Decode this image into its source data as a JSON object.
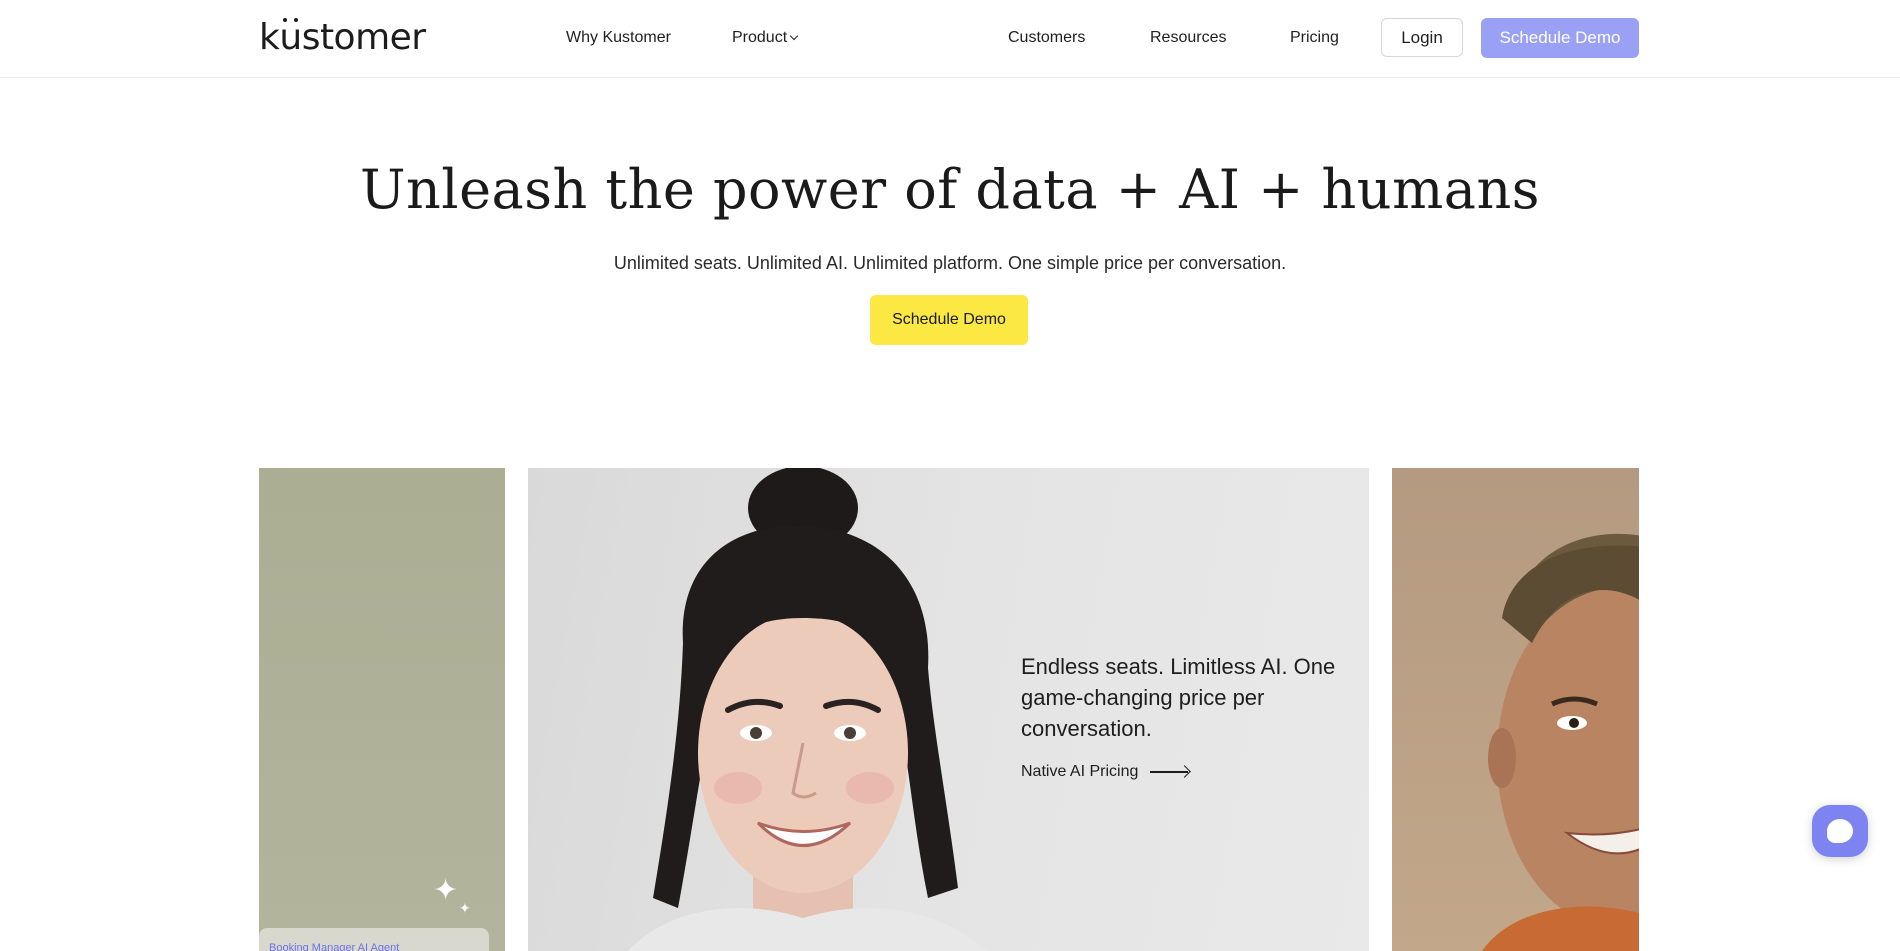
{
  "nav": {
    "logo": "kustomer",
    "links": [
      {
        "label": "Why Kustomer"
      },
      {
        "label": "Product"
      },
      {
        "label": "Customers"
      },
      {
        "label": "Resources"
      },
      {
        "label": "Pricing"
      }
    ],
    "login_label": "Login",
    "demo_label": "Schedule Demo"
  },
  "hero": {
    "title": "Unleash the power of data + AI + humans",
    "subtitle": "Unlimited seats. Unlimited AI. Unlimited platform. One simple price per conversation.",
    "cta_label": "Schedule Demo"
  },
  "cards": {
    "left": {
      "panel_label": "Booking Manager AI Agent"
    },
    "main": {
      "text": "Endless seats. Limitless AI. One game-changing price per conversation.",
      "link_label": "Native AI Pricing"
    }
  },
  "colors": {
    "accent_purple": "#9aa0f4",
    "cta_yellow": "#fbe843",
    "chat_button": "#7d83f0"
  },
  "icons": {
    "product_dropdown": "chevron-down-icon",
    "sparkle": "sparkle-icon",
    "link_arrow": "arrow-right-icon",
    "chat": "chat-bubble-icon"
  }
}
